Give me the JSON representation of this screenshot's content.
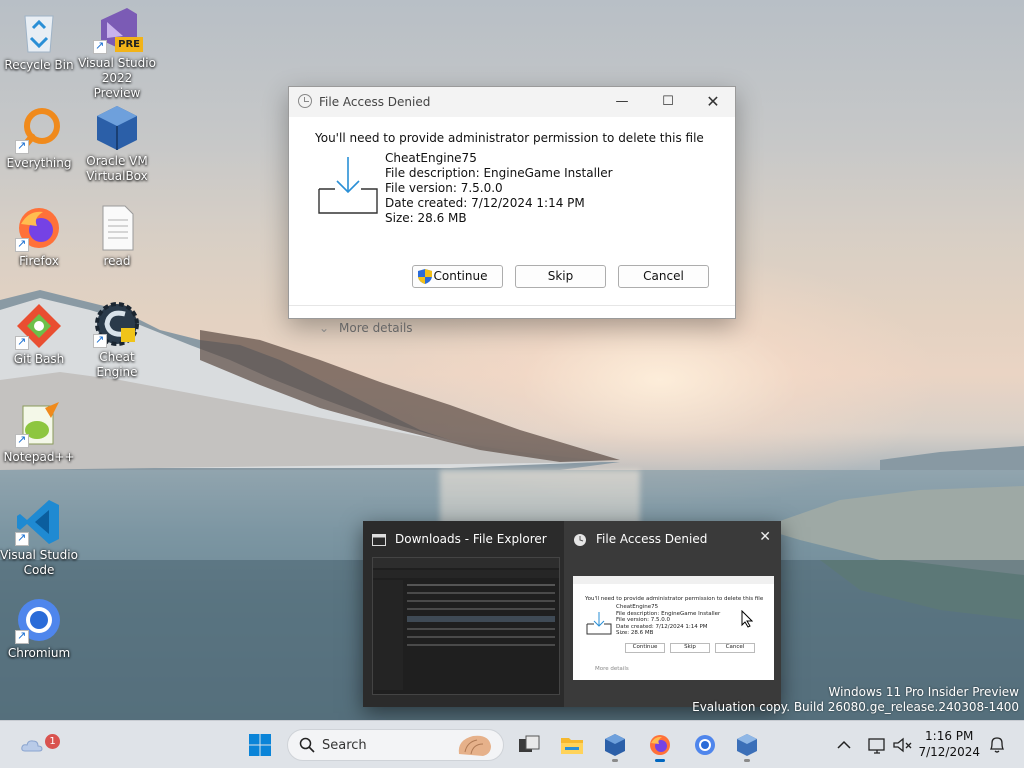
{
  "desktop": {
    "icons": [
      {
        "label": "Recycle Bin"
      },
      {
        "label": "Visual Studio 2022 Preview",
        "badge": "PRE"
      },
      {
        "label": "Everything"
      },
      {
        "label": "Oracle VM VirtualBox"
      },
      {
        "label": "Firefox"
      },
      {
        "label": "read"
      },
      {
        "label": "Git Bash"
      },
      {
        "label": "Cheat Engine"
      },
      {
        "label": "Notepad++"
      },
      {
        "label": "Visual Studio Code"
      },
      {
        "label": "Chromium"
      }
    ]
  },
  "dialog": {
    "title": "File Access Denied",
    "message": "You'll need to provide administrator permission to delete this file",
    "file_name": "CheatEngine75",
    "description": "File description: EngineGame Installer",
    "version": "File version: 7.5.0.0",
    "date_created": "Date created: 7/12/2024 1:14 PM",
    "size": "Size: 28.6 MB",
    "buttons": {
      "continue": "Continue",
      "skip": "Skip",
      "cancel": "Cancel"
    },
    "more_details": "More details"
  },
  "preview": {
    "items": [
      {
        "title": "Downloads - File Explorer"
      },
      {
        "title": "File Access Denied"
      }
    ],
    "thumb_text": {
      "message": "You'll need to provide administrator permission to delete this file",
      "file_name": "CheatEngine75",
      "description": "File description: EngineGame Installer",
      "version": "File version: 7.5.0.0",
      "date_created": "Date created: 7/12/2024 1:14 PM",
      "size": "Size: 28.6 MB",
      "continue": "Continue",
      "skip": "Skip",
      "cancel": "Cancel",
      "more_details": "More details"
    }
  },
  "watermark": {
    "line1": "Windows 11 Pro Insider Preview",
    "line2": "Evaluation copy. Build 26080.ge_release.240308-1400"
  },
  "taskbar": {
    "weather_badge": "1",
    "search_placeholder": "Search",
    "time": "1:16 PM",
    "date": "7/12/2024",
    "apps": [
      "start-icon",
      "task-view-icon",
      "file-explorer-icon",
      "virtualbox-icon",
      "firefox-icon",
      "chromium-icon",
      "virtualbox-vm-icon"
    ]
  },
  "colors": {
    "accent": "#0067c0",
    "taskbar": "#dfe3e8",
    "preview_bg": "#2b2b2b"
  }
}
